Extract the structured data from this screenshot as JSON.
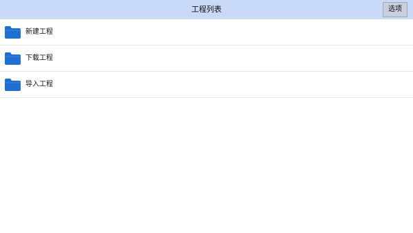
{
  "header": {
    "title": "工程列表",
    "options_label": "选项"
  },
  "projects": [
    {
      "label": "新建工程",
      "icon": "folder-icon"
    },
    {
      "label": "下载工程",
      "icon": "folder-icon"
    },
    {
      "label": "导入工程",
      "icon": "folder-icon"
    }
  ],
  "colors": {
    "header_bg": "#c9daf8",
    "folder": "#1f6fd1"
  }
}
